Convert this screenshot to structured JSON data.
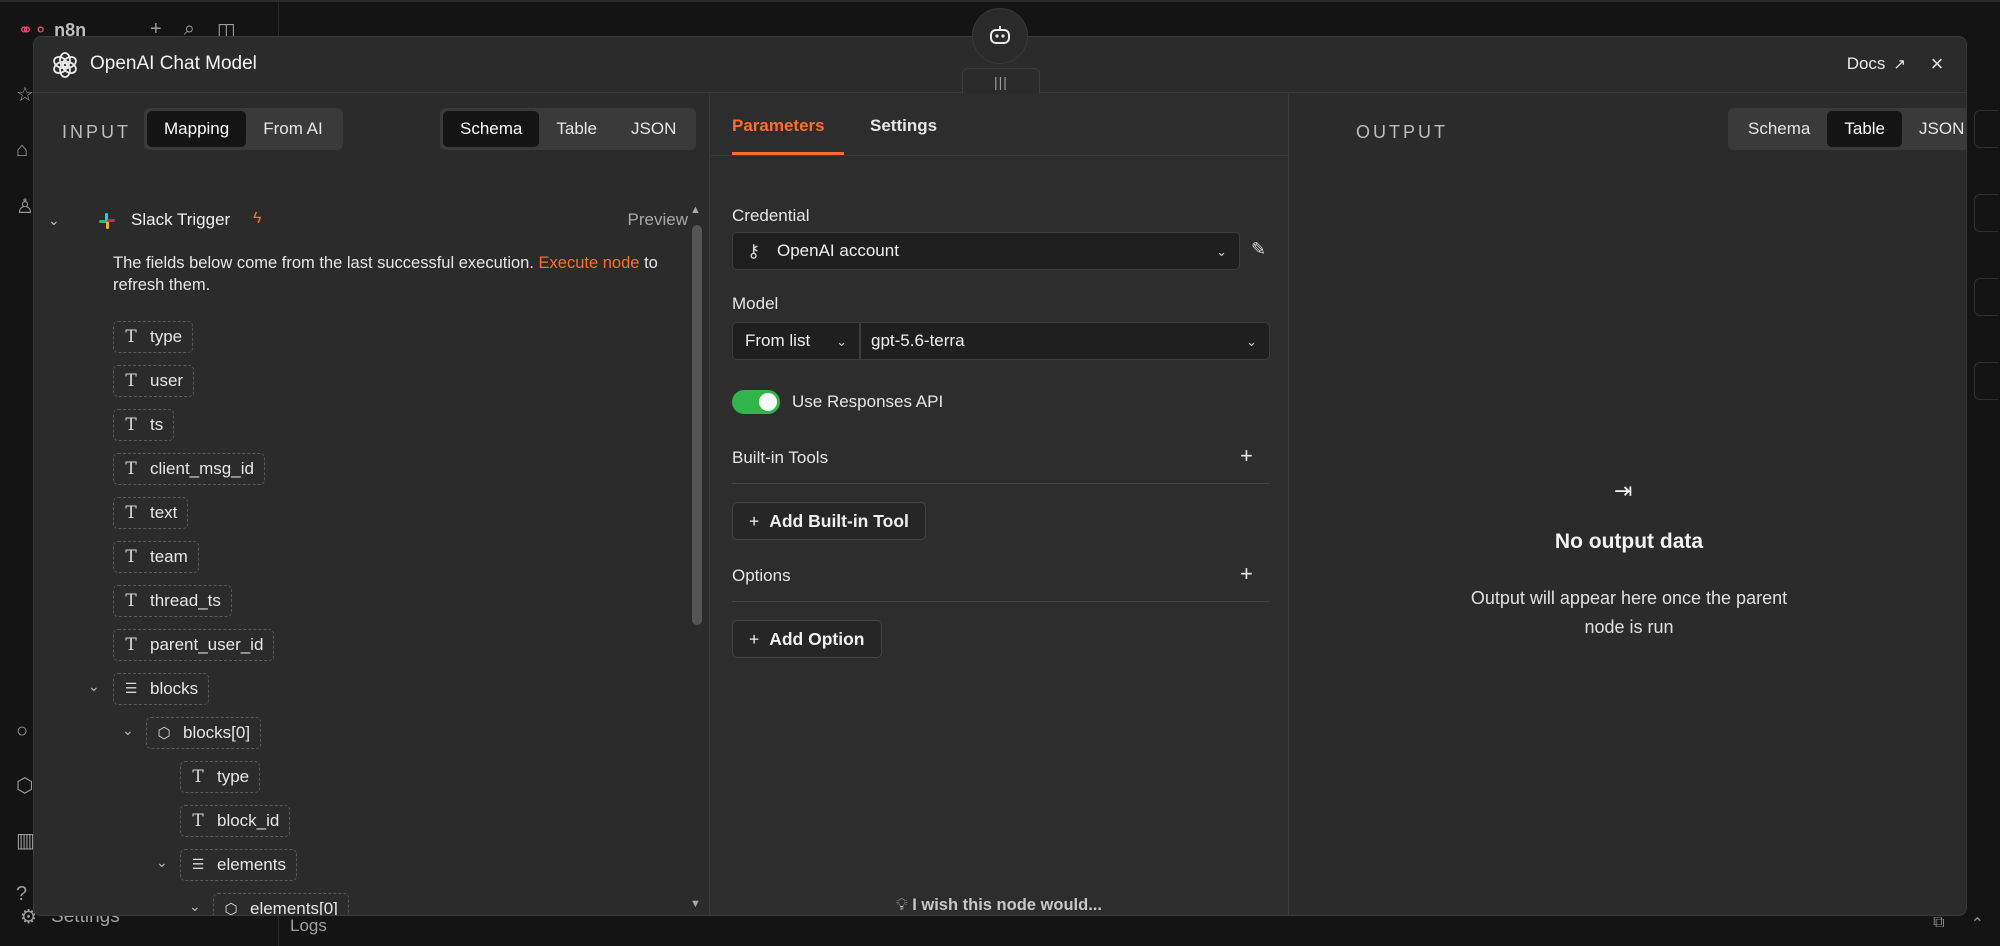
{
  "background": {
    "app_name": "n8n",
    "settings_label": "Settings",
    "logs_label": "Logs"
  },
  "modal": {
    "title": "OpenAI Chat Model",
    "docs_label": "Docs",
    "close_icon": "×"
  },
  "input": {
    "label": "INPUT",
    "mode_tabs": [
      "Mapping",
      "From AI"
    ],
    "mode_active": "Mapping",
    "view_tabs": [
      "Schema",
      "Table",
      "JSON"
    ],
    "view_active": "Schema",
    "node_name": "Slack Trigger",
    "preview_label": "Preview",
    "hint_prefix": "The fields below come from the last successful execution.",
    "hint_link": "Execute node",
    "hint_suffix": "to refresh them.",
    "fields": [
      {
        "name": "type",
        "kind": "text"
      },
      {
        "name": "user",
        "kind": "text"
      },
      {
        "name": "ts",
        "kind": "text"
      },
      {
        "name": "client_msg_id",
        "kind": "text"
      },
      {
        "name": "text",
        "kind": "text"
      },
      {
        "name": "team",
        "kind": "text"
      },
      {
        "name": "thread_ts",
        "kind": "text"
      },
      {
        "name": "parent_user_id",
        "kind": "text"
      },
      {
        "name": "blocks",
        "kind": "array"
      },
      {
        "name": "blocks[0]",
        "kind": "object"
      },
      {
        "name": "type",
        "kind": "text"
      },
      {
        "name": "block_id",
        "kind": "text"
      },
      {
        "name": "elements",
        "kind": "array"
      },
      {
        "name": "elements[0]",
        "kind": "object"
      }
    ]
  },
  "parameters": {
    "tabs": [
      "Parameters",
      "Settings"
    ],
    "active_tab": "Parameters",
    "credential_label": "Credential",
    "credential_value": "OpenAI account",
    "model_label": "Model",
    "model_mode": "From list",
    "model_value": "gpt-5.6-terra",
    "responses_api_label": "Use Responses API",
    "responses_api_on": true,
    "builtin_tools_label": "Built-in Tools",
    "add_builtin_tool_label": "Add Built-in Tool",
    "options_label": "Options",
    "add_option_label": "Add Option",
    "wish_label": "I wish this node would..."
  },
  "output": {
    "label": "OUTPUT",
    "view_tabs": [
      "Schema",
      "Table",
      "JSON"
    ],
    "view_active": "Table",
    "empty_title": "No output data",
    "empty_desc": "Output will appear here once the parent node is run"
  },
  "colors": {
    "accent": "#ff6d2d",
    "toggle_on": "#2fb54a",
    "modal_bg": "#2b2b2b",
    "page_bg": "#141414"
  }
}
